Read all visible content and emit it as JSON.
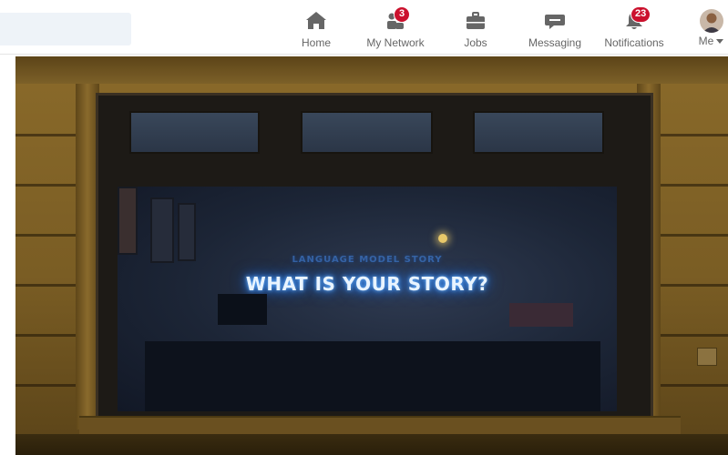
{
  "search": {
    "placeholder": ""
  },
  "nav": {
    "items": [
      {
        "label": "Home",
        "icon": "home-icon"
      },
      {
        "label": "My Network",
        "icon": "network-icon",
        "badge": "3"
      },
      {
        "label": "Jobs",
        "icon": "briefcase-icon"
      },
      {
        "label": "Messaging",
        "icon": "chat-bubble-icon"
      },
      {
        "label": "Notifications",
        "icon": "bell-icon",
        "badge": "23"
      },
      {
        "label": "Me",
        "icon": "avatar"
      }
    ]
  },
  "photo": {
    "neon_text": "WHAT IS YOUR STORY?",
    "neon_subtext": "LANGUAGE MODEL STORY"
  },
  "colors": {
    "badge": "#cb112d",
    "nav_text": "#666666",
    "icon": "#666666",
    "search_bg": "#eef3f8",
    "neon": "#2e8cff"
  }
}
